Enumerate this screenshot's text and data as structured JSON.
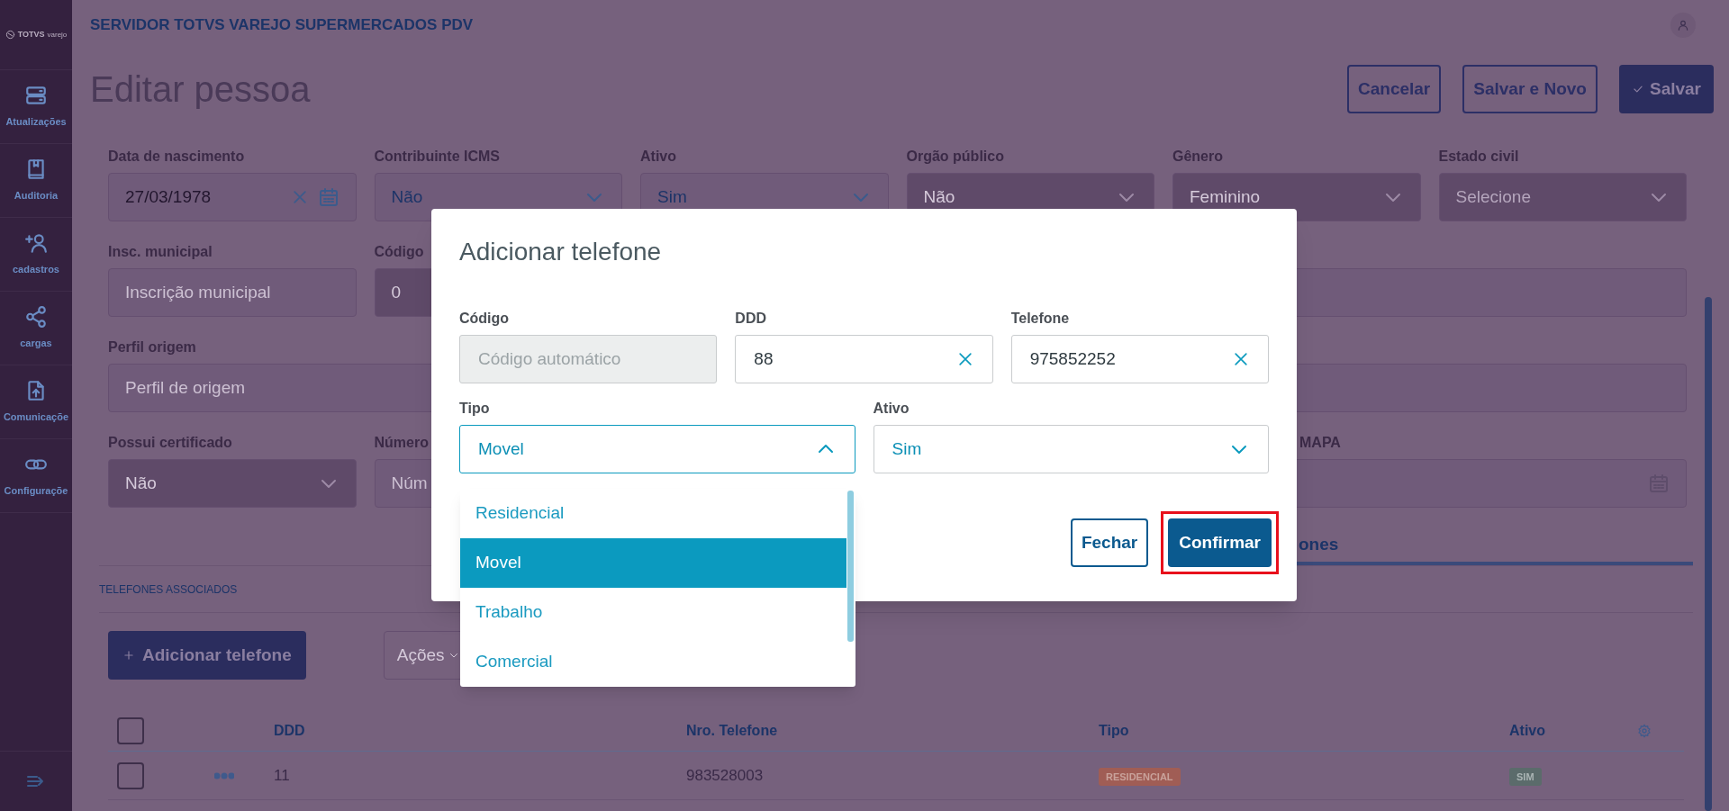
{
  "sidebar": {
    "logo": {
      "brand": "TOTVS",
      "sub": "varejo"
    },
    "items": [
      {
        "label": "Atualizações"
      },
      {
        "label": "Auditoria"
      },
      {
        "label": "cadastros"
      },
      {
        "label": "cargas"
      },
      {
        "label": "Comunicaçõe"
      },
      {
        "label": "Configuraçõe"
      }
    ]
  },
  "header": {
    "title": "SERVIDOR TOTVS VAREJO SUPERMERCADOS PDV"
  },
  "page": {
    "title": "Editar pessoa",
    "actions": [
      {
        "label": "Cancelar",
        "kind": "outline"
      },
      {
        "label": "Salvar e Novo",
        "kind": "outline"
      },
      {
        "label": "Salvar",
        "kind": "primary"
      }
    ]
  },
  "form": {
    "rows": [
      [
        {
          "label": "Data de nascimento",
          "kind": "date",
          "value": "27/03/1978",
          "disabled": false
        },
        {
          "label": "Contribuinte ICMS",
          "kind": "select",
          "value": "Não",
          "disabled": false
        },
        {
          "label": "Ativo",
          "kind": "select",
          "value": "Sim",
          "disabled": false
        },
        {
          "label": "Orgão público",
          "kind": "select",
          "value": "Não",
          "disabled": true
        },
        {
          "label": "Gênero",
          "kind": "select",
          "value": "Feminino",
          "disabled": true
        },
        {
          "label": "Estado civil",
          "kind": "select",
          "placeholder": "Selecione",
          "disabled": true
        }
      ],
      [
        {
          "label": "Insc. municipal",
          "kind": "text",
          "placeholder": "Inscrição municipal",
          "disabled": false
        },
        {
          "label": "Código",
          "kind": "text",
          "value": "0",
          "disabled": true
        },
        {
          "kind": "text",
          "disabled": false
        }
      ],
      [
        {
          "label": "Perfil origem",
          "kind": "text",
          "placeholder": "Perfil de origem",
          "disabled": false
        }
      ],
      [
        {
          "label": "Possui certificado",
          "kind": "select",
          "value": "Não",
          "disabled": true
        },
        {
          "label": "Número",
          "kind": "text",
          "placeholder": "Núm",
          "disabled": false
        },
        {
          "label": "MAPA",
          "kind": "date",
          "disabled": false
        }
      ]
    ]
  },
  "tabs": [
    {
      "label": "ones",
      "selected": true
    }
  ],
  "phones": {
    "heading": "TELEFONES ASSOCIADOS",
    "add_button": "Adicionar telefone",
    "actions_select": "Ações",
    "table": {
      "select_all": false,
      "columns": [
        "DDD",
        "Nro. Telefone",
        "Tipo",
        "Ativo"
      ],
      "rows": [
        {
          "checked": false,
          "ddd": "11",
          "numero": "983528003",
          "tipo": "RESIDENCIAL",
          "ativo": "SIM"
        }
      ]
    }
  },
  "modal": {
    "title": "Adicionar telefone",
    "fields": [
      {
        "label": "Código",
        "kind": "text",
        "placeholder": "Código automático",
        "disabled": true
      },
      {
        "label": "DDD",
        "kind": "clearable",
        "value": "88",
        "disabled": false
      },
      {
        "label": "Telefone",
        "kind": "clearable",
        "value": "975852252",
        "disabled": false
      },
      {
        "label": "Tipo",
        "kind": "select",
        "value": "Movel",
        "expanded": true
      },
      {
        "label": "Ativo",
        "kind": "select",
        "value": "Sim",
        "expanded": false
      }
    ],
    "dropdown": [
      {
        "label": "Residencial",
        "selected": false
      },
      {
        "label": "Movel",
        "selected": true
      },
      {
        "label": "Trabalho",
        "selected": false
      },
      {
        "label": "Comercial",
        "selected": false
      }
    ],
    "buttons": [
      {
        "label": "Fechar",
        "kind": "outline",
        "highlighted": false
      },
      {
        "label": "Confirmar",
        "kind": "primary",
        "highlighted": true
      }
    ]
  }
}
